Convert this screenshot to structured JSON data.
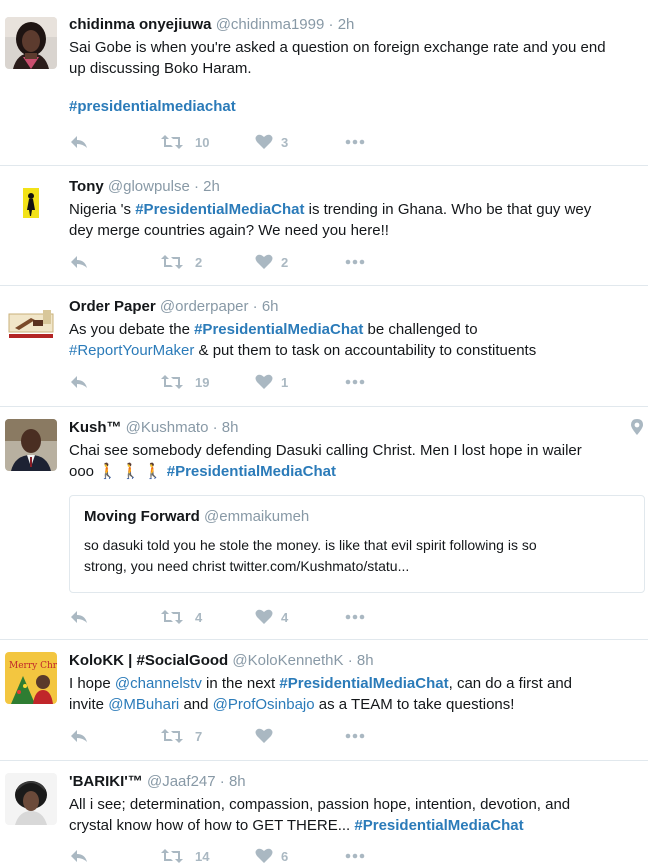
{
  "tweets": [
    {
      "name": "chidinma onyejiuwa",
      "handle": "@chidinma1999",
      "sep": "·",
      "time": "2h",
      "line1": "Sai Gobe is when you're asked a question on foreign exchange rate and you end",
      "line2": "up discussing Boko Haram.",
      "hashtag": "#presidentialmediachat",
      "retweets": "10",
      "likes": "3"
    },
    {
      "name": "Tony",
      "handle": "@glowpulse",
      "sep": "·",
      "time": "2h",
      "pre": "Nigeria 's ",
      "hashtag": "#PresidentialMediaChat",
      "post": " is trending in Ghana. Who be that guy wey",
      "line2": "dey merge countries again? We need you here!!",
      "retweets": "2",
      "likes": "2"
    },
    {
      "name": "Order Paper",
      "handle": "@orderpaper",
      "sep": "·",
      "time": "6h",
      "pre": "As you debate the ",
      "hashtag": "#PresidentialMediaChat",
      "post": " be challenged to",
      "hashtag2": "#ReportYourMaker",
      "post2": " & put them to task on accountability to constituents",
      "retweets": "19",
      "likes": "1"
    },
    {
      "name": "Kush™",
      "handle": "@Kushmato",
      "sep": "·",
      "time": "8h",
      "line1": "Chai see somebody defending Dasuki calling Christ. Men I lost hope in wailer",
      "pre2": "ooo 🚶 🚶 🚶 ",
      "hashtag": "#PresidentialMediaChat",
      "quote": {
        "name": "Moving Forward",
        "handle": "@emmaikumeh",
        "line1": "so dasuki told you he stole the money. is like that evil spirit following is so",
        "line2": "strong, you need christ twitter.com/Kushmato/statu..."
      },
      "retweets": "4",
      "likes": "4"
    },
    {
      "name": "KoloKK | #SocialGood",
      "handle": "@KoloKennethK",
      "sep": "·",
      "time": "8h",
      "pre": "I hope ",
      "mention1": "@channelstv",
      "mid": " in the next ",
      "hashtag": "#PresidentialMediaChat",
      "post": ", can do a first and",
      "pre2": "invite ",
      "mention2": "@MBuhari",
      "mid2": " and ",
      "mention3": "@ProfOsinbajo",
      "post2": " as a TEAM to take questions!",
      "retweets": "7",
      "likes": ""
    },
    {
      "name": "'BARIKI'™",
      "handle": "@Jaaf247",
      "sep": "·",
      "time": "8h",
      "line1": "All i see; determination, compassion, passion hope, intention, devotion, and",
      "pre2": "crystal know how of how to GET THERE... ",
      "hashtag": "#PresidentialMediaChat",
      "retweets": "14",
      "likes": "6"
    }
  ],
  "avatar5_text": "Merry Christmas",
  "colors": {
    "link": "#2b7bb9",
    "muted": "#8899a6",
    "icon": "#aab8c2",
    "border": "#e1e8ed"
  },
  "icons": [
    "reply-icon",
    "retweet-icon",
    "heart-icon",
    "more-icon",
    "location-pin-icon"
  ]
}
